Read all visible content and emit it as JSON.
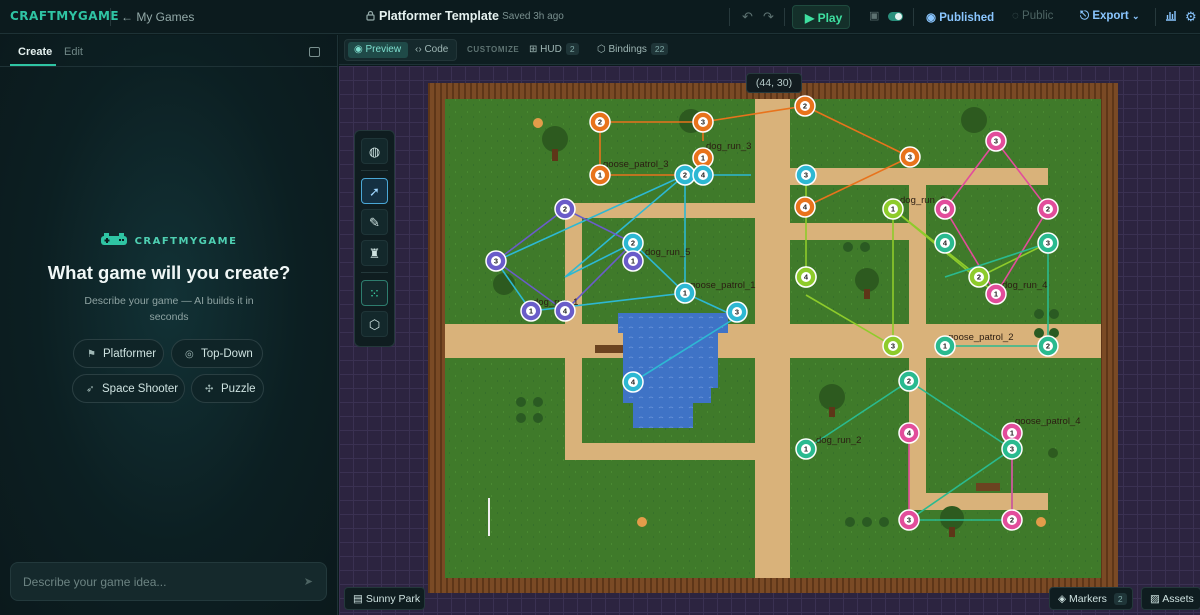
{
  "brand": "CRAFTMYGAME",
  "header": {
    "back_label": "My Games",
    "project_title": "Platformer Template",
    "saved_status": "Saved 3h ago",
    "play_label": "Play",
    "published_label": "Published",
    "public_label": "Public",
    "export_label": "Export"
  },
  "left_panel": {
    "tabs": [
      "Create",
      "Edit"
    ],
    "logo_text": "CRAFTMYGAME",
    "headline": "What game will you create?",
    "subtitle": "Describe your game — AI builds it in seconds",
    "chips": [
      {
        "label": "Platformer",
        "icon": "platformer-icon"
      },
      {
        "label": "Top-Down",
        "icon": "compass-icon"
      },
      {
        "label": "Space Shooter",
        "icon": "rocket-icon"
      },
      {
        "label": "Puzzle",
        "icon": "puzzle-icon"
      }
    ],
    "input_placeholder": "Describe your game idea..."
  },
  "subbar": {
    "preview_label": "Preview",
    "code_label": "Code",
    "customize_label": "CUSTOMIZE",
    "hud_label": "HUD",
    "hud_count": "2",
    "bindings_label": "Bindings",
    "bindings_count": "22"
  },
  "canvas": {
    "coordinate_readout": "(44, 30)",
    "scene_label": "Sunny Park",
    "markers_label": "Markers",
    "markers_count": "2",
    "assets_label": "Assets",
    "tools": [
      "globe-icon",
      "select-cursor-icon",
      "brush-icon",
      "robot-icon",
      "grid-icon",
      "cube-icon"
    ]
  },
  "map": {
    "colors": {
      "fence": "#7a4a25",
      "grass": "#3f7a2a",
      "path": "#d9b27a",
      "water": "#3f73c6"
    },
    "path_labels": [
      {
        "id": "goose_patrol_3",
        "label": "goose_patrol_3",
        "color": "#e8731c"
      },
      {
        "id": "dog_run_3",
        "label": "dog_run_3",
        "color": "#e8731c"
      },
      {
        "id": "dog_run_5",
        "label": "dog_run_5",
        "color": "#2db8d3"
      },
      {
        "id": "goose_patrol_1",
        "label": "goose_patrol_1",
        "color": "#2db8d3"
      },
      {
        "id": "dog_run_1",
        "label": "dog_run_1",
        "color": "#6a5cc9"
      },
      {
        "id": "dog_run_6",
        "label": "dog_run_6",
        "color": "#8ecb2b"
      },
      {
        "id": "dog_run_4",
        "label": "dog_run_4",
        "color": "#e24d9b"
      },
      {
        "id": "goose_patrol_2",
        "label": "goose_patrol_2",
        "color": "#2aba8f"
      },
      {
        "id": "dog_run_2",
        "label": "dog_run_2",
        "color": "#2aba8f"
      },
      {
        "id": "goose_patrol_4",
        "label": "goose_patrol_4",
        "color": "#2aba8f"
      }
    ]
  }
}
